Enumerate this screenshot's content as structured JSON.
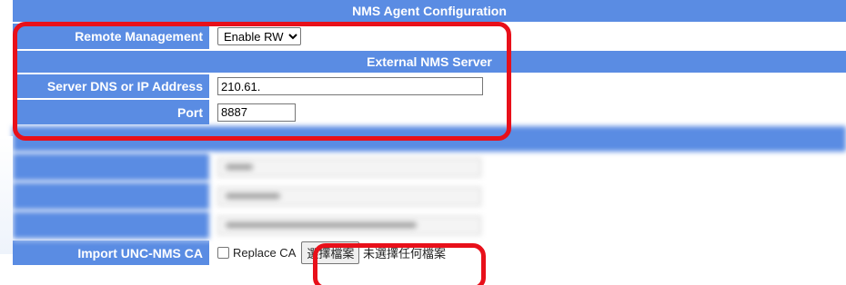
{
  "section_title": "NMS Agent Configuration",
  "remote_management": {
    "label": "Remote Management",
    "selected": "Enable RW"
  },
  "external_server": {
    "title": "External NMS Server",
    "dns_label": "Server DNS or IP Address",
    "dns_value": "210.61.",
    "port_label": "Port",
    "port_value": "8887"
  },
  "import_ca": {
    "label": "Import UNC-NMS CA",
    "checkbox_label": "Replace CA",
    "button_label": "選擇檔案",
    "file_status": "未選擇任何檔案"
  },
  "colors": {
    "header_bg": "#5a8ce3",
    "highlight": "#e8101a"
  }
}
